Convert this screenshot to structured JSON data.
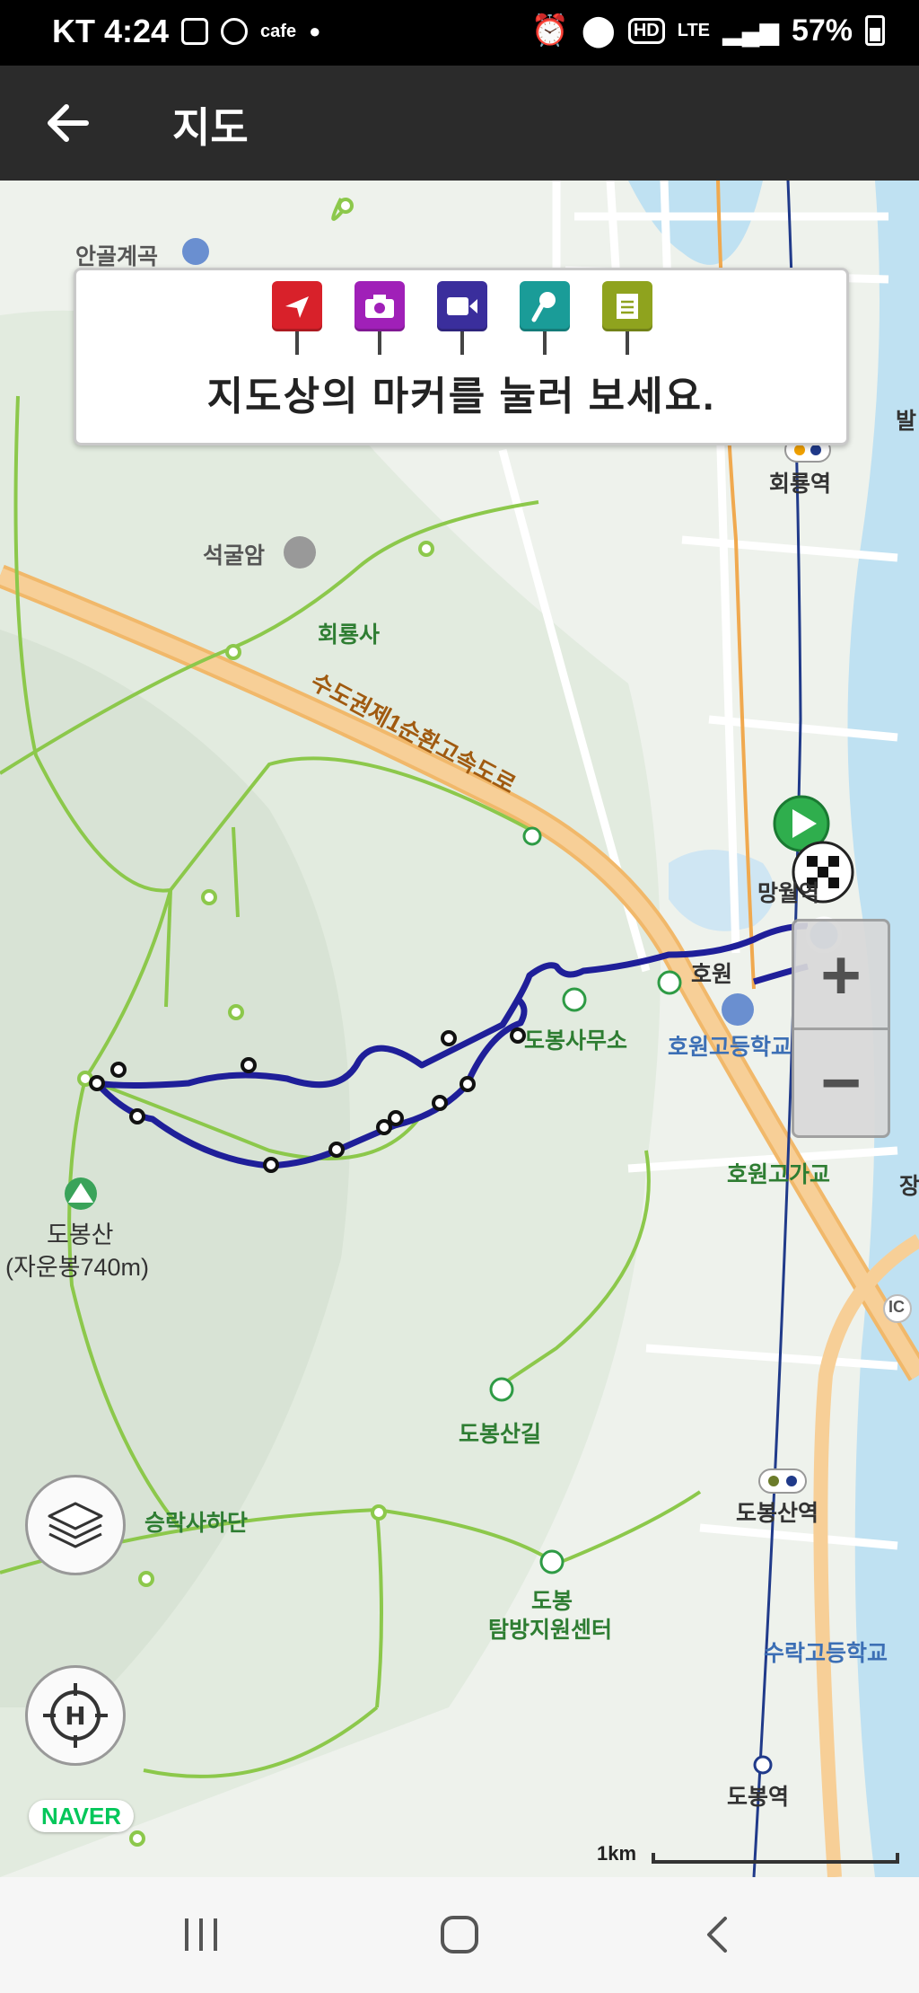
{
  "status_bar": {
    "carrier_time": "KT 4:24",
    "cafe_label": "cafe",
    "hd": "HD",
    "lte": "LTE",
    "battery": "57%"
  },
  "app_bar": {
    "title": "지도"
  },
  "marker_legend": {
    "instruction": "지도상의 마커를 눌러 보세요.",
    "markers": [
      {
        "icon": "flag-icon",
        "color": "#d8212a"
      },
      {
        "icon": "camera-icon",
        "color": "#a020b8"
      },
      {
        "icon": "video-icon",
        "color": "#3a2e9c"
      },
      {
        "icon": "microphone-icon",
        "color": "#1a9c98"
      },
      {
        "icon": "memo-icon",
        "color": "#8fa31e"
      }
    ]
  },
  "map": {
    "labels": {
      "angok": "안골계곡",
      "seokgulam": "석굴암",
      "hoeryongsa": "회룡사",
      "expressway": "수도권제1순환고속도로",
      "hoeryong_station": "회룡역",
      "bal": "발",
      "mangwol": "망월",
      "mangwol_suffix": "역",
      "howon": "호원",
      "howon_high": "호원고등학교",
      "office": "도봉사무소",
      "howon_overpass": "호원고가교",
      "jang": "장",
      "dobongsan": "도봉산",
      "jaunbong": "(자운봉740m)",
      "dobongsan_gil": "도봉산길",
      "dobongsan_station": "도봉산역",
      "seungraksa": "승락사하단",
      "dobong_center_1": "도봉",
      "dobong_center_2": "탐방지원센터",
      "surak_high": "수락고등학교",
      "dobong_station": "도봉역",
      "ic": "IC"
    },
    "zoom_in": "+",
    "zoom_out": "−",
    "naver": "NAVER",
    "scale": "1km",
    "colors": {
      "route": "#1f1f99",
      "trail": "#8cc84b",
      "road": "#f5c07a",
      "water": "#a9d8f0"
    }
  },
  "nav_bar": {
    "recent": "recents-icon",
    "home": "home-icon",
    "back": "back-icon"
  }
}
